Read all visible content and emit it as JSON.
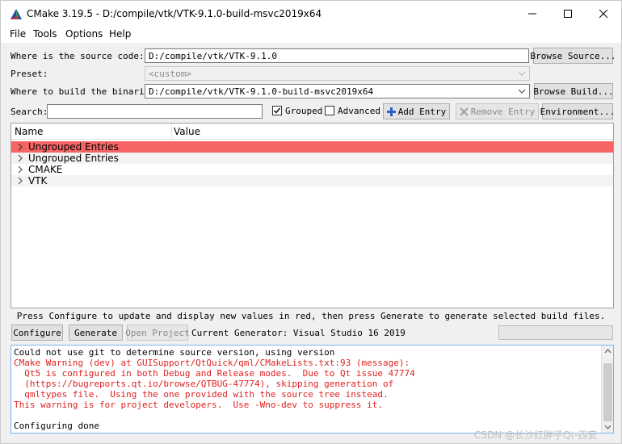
{
  "window": {
    "title": "CMake 3.19.5 - D:/compile/vtk/VTK-9.1.0-build-msvc2019x64",
    "minimize_icon": "minimize-icon",
    "maximize_icon": "maximize-icon",
    "close_icon": "close-icon",
    "app_icon": "cmake-triangle-icon"
  },
  "menu": {
    "items": [
      {
        "label": "File"
      },
      {
        "label": "Tools"
      },
      {
        "label": "Options"
      },
      {
        "label": "Help"
      }
    ]
  },
  "source": {
    "label": "Where is the source code:",
    "value": "D:/compile/vtk/VTK-9.1.0",
    "browse_label": "Browse Source..."
  },
  "preset": {
    "label": "Preset:",
    "value": "<custom>"
  },
  "build": {
    "label": "Where to build the binaries:",
    "value": "D:/compile/vtk/VTK-9.1.0-build-msvc2019x64",
    "browse_label": "Browse Build..."
  },
  "search": {
    "label": "Search:",
    "value": "",
    "grouped_label": "Grouped",
    "grouped_checked": true,
    "advanced_label": "Advanced",
    "advanced_checked": false,
    "add_entry_label": "Add Entry",
    "remove_entry_label": "Remove Entry",
    "environment_label": "Environment..."
  },
  "tree": {
    "col_name": "Name",
    "col_value": "Value",
    "rows": [
      {
        "label": "Ungrouped Entries",
        "highlighted": true
      },
      {
        "label": "Ungrouped Entries",
        "highlighted": false
      },
      {
        "label": "CMAKE",
        "highlighted": false
      },
      {
        "label": "VTK",
        "highlighted": false
      }
    ]
  },
  "hint": "Press Configure to update and display new values in red, then press Generate to generate selected build files.",
  "actions": {
    "configure_label": "Configure",
    "generate_label": "Generate",
    "open_project_label": "Open Project",
    "generator_text": "Current Generator: Visual Studio 16 2019"
  },
  "output": {
    "lines": [
      {
        "text": "Could not use git to determine source version, using version",
        "color": "black"
      },
      {
        "text": "CMake Warning (dev) at GUISupport/QtQuick/qml/CMakeLists.txt:93 (message):",
        "color": "red"
      },
      {
        "text": "  Qt5 is configured in both Debug and Release modes.  Due to Qt issue 47774",
        "color": "red"
      },
      {
        "text": "  (https://bugreports.qt.io/browse/QTBUG-47774), skipping generation of",
        "color": "red"
      },
      {
        "text": "  qmltypes file.  Using the one provided with the source tree instead.",
        "color": "red"
      },
      {
        "text": "This warning is for project developers.  Use -Wno-dev to suppress it.",
        "color": "red"
      },
      {
        "text": "",
        "color": "black"
      },
      {
        "text": "Configuring done",
        "color": "black"
      }
    ]
  },
  "watermark": "CSDN @长沙红胖子Qt-西安",
  "colors": {
    "highlight_row": "#f76464",
    "warning_text": "#e02020",
    "output_border": "#7eb4ea"
  }
}
